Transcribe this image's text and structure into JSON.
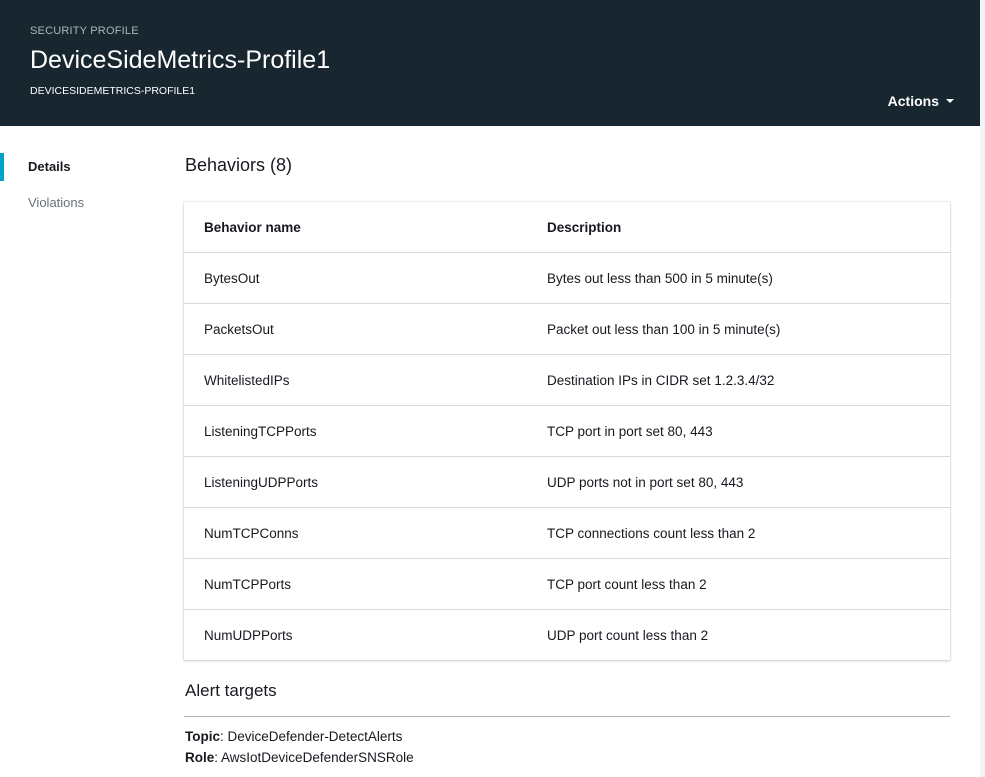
{
  "header": {
    "kicker": "SECURITY PROFILE",
    "title": "DeviceSideMetrics-Profile1",
    "subtitle": "DEVICESIDEMETRICS-PROFILE1",
    "actions_label": "Actions"
  },
  "sidenav": {
    "items": [
      {
        "label": "Details",
        "active": true
      },
      {
        "label": "Violations",
        "active": false
      }
    ]
  },
  "behaviors": {
    "title": "Behaviors (8)",
    "columns": [
      "Behavior name",
      "Description"
    ],
    "rows": [
      {
        "name": "BytesOut",
        "description": "Bytes out less than 500 in 5 minute(s)"
      },
      {
        "name": "PacketsOut",
        "description": "Packet out less than 100 in 5 minute(s)"
      },
      {
        "name": "WhitelistedIPs",
        "description": "Destination IPs in CIDR set 1.2.3.4/32"
      },
      {
        "name": "ListeningTCPPorts",
        "description": "TCP port in port set 80, 443"
      },
      {
        "name": "ListeningUDPPorts",
        "description": "UDP ports not in port set 80, 443"
      },
      {
        "name": "NumTCPConns",
        "description": "TCP connections count less than 2"
      },
      {
        "name": "NumTCPPorts",
        "description": "TCP port count less than 2"
      },
      {
        "name": "NumUDPPorts",
        "description": "UDP port count less than 2"
      }
    ]
  },
  "alert_targets": {
    "title": "Alert targets",
    "topic_label": "Topic",
    "topic_value": "DeviceDefender-DetectAlerts",
    "role_label": "Role",
    "role_value": "AwsIotDeviceDefenderSNSRole"
  },
  "colors": {
    "header_bg": "#17262f",
    "accent": "#00a1c9"
  }
}
